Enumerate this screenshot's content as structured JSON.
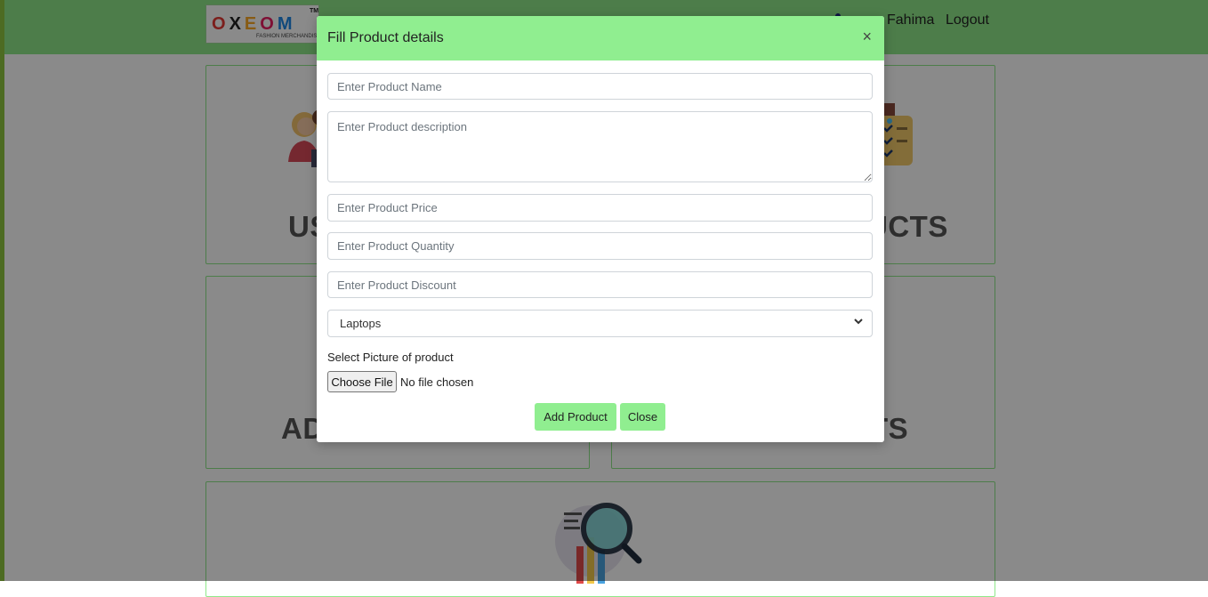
{
  "navbar": {
    "logo": {
      "letters": [
        "O",
        "X",
        "E",
        "O",
        "M"
      ],
      "tagline": "FASHION MERCHANDISE",
      "trademark": "TM"
    },
    "user_name": "Fahima",
    "logout_label": "Logout"
  },
  "dashboard": {
    "cards": [
      {
        "title_visible": "US",
        "title_visible_right": "UCTS"
      },
      {
        "title_visible": "AD",
        "title_visible_right": "TS"
      }
    ]
  },
  "modal": {
    "title": "Fill Product details",
    "close_symbol": "×",
    "fields": {
      "name_placeholder": "Enter Product Name",
      "description_placeholder": "Enter Product description",
      "price_placeholder": "Enter Product Price",
      "quantity_placeholder": "Enter Product Quantity",
      "discount_placeholder": "Enter Product Discount"
    },
    "category_selected": "Laptops",
    "file_label": "Select Picture of product",
    "file_button": "Choose File",
    "file_status": "No file chosen",
    "add_button": "Add Product",
    "close_button": "Close"
  },
  "colors": {
    "accent_green": "#90ee90",
    "left_strip": "#8ec63f"
  }
}
